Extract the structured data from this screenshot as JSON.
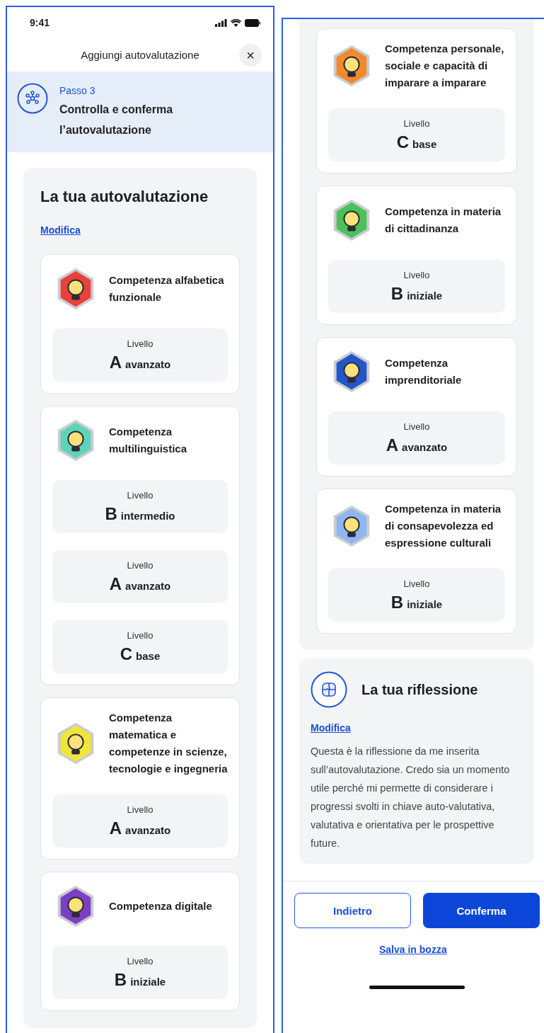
{
  "screens": [
    {
      "status_bar": {
        "time": "9:41"
      },
      "header": {
        "title": "Aggiungi autovalutazione",
        "close": "×"
      },
      "step": {
        "label": "Passo 3",
        "title": "Controlla e conferma l’autovalutazione"
      },
      "section": {
        "title": "La tua autovalutazione",
        "edit_link": "Modifica",
        "competences": [
          {
            "name": "Competenza alfabetica funzionale",
            "color": "#e8413b",
            "levels": [
              {
                "label": "Livello",
                "letter": "A",
                "word": "avanzato"
              }
            ]
          },
          {
            "name": "Competenza multilinguistica",
            "color": "#5fd3b5",
            "levels": [
              {
                "label": "Livello",
                "letter": "B",
                "word": "intermedio"
              },
              {
                "label": "Livello",
                "letter": "A",
                "word": "avanzato"
              },
              {
                "label": "Livello",
                "letter": "C",
                "word": "base"
              }
            ]
          },
          {
            "name": "Competenza matematica e competenze in scienze, tecnologie e ingegneria",
            "color": "#f2e53a",
            "levels": [
              {
                "label": "Livello",
                "letter": "A",
                "word": "avanzato"
              }
            ]
          },
          {
            "name": "Competenza digitale",
            "color": "#7b3fc4",
            "levels": [
              {
                "label": "Livello",
                "letter": "B",
                "word": "iniziale"
              }
            ]
          }
        ]
      }
    },
    {
      "section": {
        "competences": [
          {
            "name": "Competenza personale, sociale e capacità di imparare a imparare",
            "color": "#f08a2c",
            "levels": [
              {
                "label": "Livello",
                "letter": "C",
                "word": "base"
              }
            ]
          },
          {
            "name": "Competenza in materia di cittadinanza",
            "color": "#4fbf5a",
            "levels": [
              {
                "label": "Livello",
                "letter": "B",
                "word": "iniziale"
              }
            ]
          },
          {
            "name": "Competenza imprenditoriale",
            "color": "#2456c8",
            "levels": [
              {
                "label": "Livello",
                "letter": "A",
                "word": "avanzato"
              }
            ]
          },
          {
            "name": "Competenza in materia di consapevolezza ed espressione culturali",
            "color": "#8fb6f0",
            "levels": [
              {
                "label": "Livello",
                "letter": "B",
                "word": "iniziale"
              }
            ]
          }
        ]
      },
      "reflection": {
        "title": "La tua riflessione",
        "edit_link": "Modifica",
        "text": "Questa è la riflessione da me inserita sull’autovalutazione. Credo sia un momento utile perché mi permette di considerare i progressi svolti in chiave auto-valutativa, valutativa e orientativa per le prospettive future."
      },
      "footer": {
        "back": "Indietro",
        "confirm": "Conferma",
        "draft": "Salva in bozza"
      }
    }
  ]
}
